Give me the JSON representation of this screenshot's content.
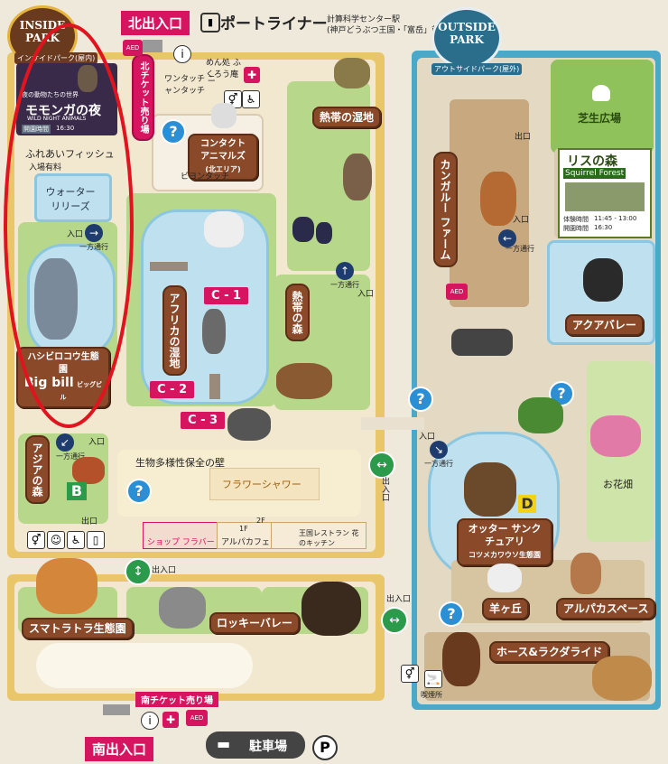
{
  "header": {
    "north_entrance": "北出入口",
    "portliner_label": "ポートライナー",
    "station_line1": "計算科学センター駅",
    "station_line2": "(神戸どうぶつ王国・「富岳」前)"
  },
  "badges": {
    "inside_title": "INSIDE PARK",
    "inside_sub": "インサイドパーク(屋内)",
    "outside_title": "OUTSIDE PARK",
    "outside_sub": "アウトサイドパーク(屋外)"
  },
  "inside": {
    "momonga_sub": "夜の動物たちの世界",
    "momonga_title": "モモンガの夜",
    "momonga_en": "WILD NIGHT ANIMALS",
    "momonga_hours_label": "開園時間",
    "momonga_hours": "16:30",
    "north_ticket": "北チケット売り場",
    "menrui": "めん処 ふくろう庵",
    "wantatch": "ワンタッチ ニャンタッチ",
    "fishing": "ふれあいフィッシュ",
    "fishing_fee": "入場有料",
    "water_lilies": "ウォーター リリーズ",
    "contact_animals": "コンタクト アニマルズ",
    "contact_sub": "(北エリア)",
    "beyon_touch": "ビヨンタッチ",
    "tropical_wetland": "熱帯の湿地",
    "africa_wetland": "アフリカの湿地",
    "tropical_forest": "熱帯の森",
    "c1": "C - 1",
    "c2": "C - 2",
    "c3": "C - 3",
    "entrance": "入口",
    "exit": "出口",
    "entrance_exit": "出入口",
    "one_way": "一方通行",
    "shoebill_title": "ハシビロコウ生態園",
    "shoebill_name": "Big bill",
    "shoebill_sub": "ビッグビル",
    "asia_forest": "アジアの森",
    "b_label": "B",
    "biodiversity_wall": "生物多様性保全の壁",
    "flower_shower": "フラワーシャワー",
    "shop": "ショップ フラバード",
    "alpaca_cafe_floor": "1F",
    "alpaca_cafe": "アルパカフェ",
    "floor2": "2F",
    "restaurant": "王国レストラン 花のキッチン",
    "tiger": "スマトラトラ生態園",
    "rocky_valley": "ロッキーバレー",
    "south_ticket": "南チケット売り場",
    "south_entrance": "南出入口",
    "parking": "駐車場",
    "parking_p": "P",
    "aed": "AED"
  },
  "outside": {
    "lawn": "芝生広場",
    "kangaroo": "カンガルー ファーム",
    "squirrel_title": "リスの森",
    "squirrel_en": "Squirrel Forest",
    "squirrel_hours_label": "体験時間",
    "squirrel_hours": "11:45 - 13:00",
    "squirrel_open_label": "開園時間",
    "squirrel_open": "16:30",
    "aqua_valley": "アクアバレー",
    "flower_field": "お花畑",
    "otter_title": "オッター サンクチュアリ",
    "otter_sub": "コツメカワウソ生態園",
    "d_label": "D",
    "sheep_hill": "羊ヶ丘",
    "alpaca_space": "アルパカスペース",
    "horse_ride": "ホース&ラクダライド",
    "smoking": "喫煙所"
  },
  "colors": {
    "water": "#bfe0ee",
    "grass": "#b7d78a",
    "sign_brown": "#8a4a2a",
    "magenta": "#d6145f",
    "outside_border": "#4aa8c8",
    "inside_border": "#e6b43c",
    "highlight_ellipse": "#e0141e"
  }
}
